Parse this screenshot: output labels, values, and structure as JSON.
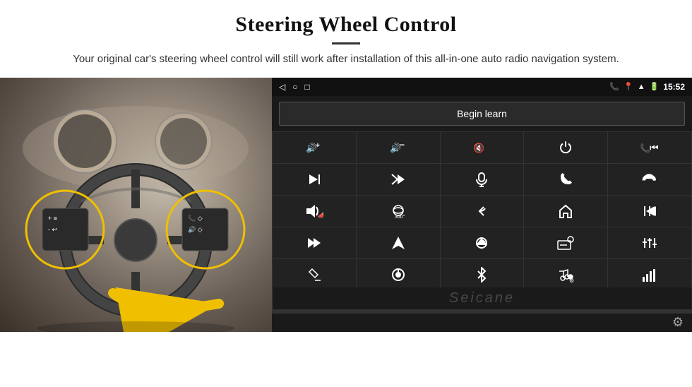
{
  "header": {
    "title": "Steering Wheel Control",
    "subtitle": "Your original car's steering wheel control will still work after installation of this all-in-one auto radio navigation system."
  },
  "status_bar": {
    "time": "15:52",
    "nav_back": "◁",
    "nav_home": "○",
    "nav_recent": "□"
  },
  "begin_learn_btn": "Begin learn",
  "watermark": "Seicane",
  "controls": [
    {
      "icon": "🔊+",
      "name": "vol-up"
    },
    {
      "icon": "🔊−",
      "name": "vol-down"
    },
    {
      "icon": "🔇",
      "name": "mute"
    },
    {
      "icon": "⏻",
      "name": "power"
    },
    {
      "icon": "📞⏮",
      "name": "call-prev"
    },
    {
      "icon": "⏭",
      "name": "next-track"
    },
    {
      "icon": "✂⏭",
      "name": "fast-forward"
    },
    {
      "icon": "🎤",
      "name": "mic"
    },
    {
      "icon": "📞",
      "name": "call"
    },
    {
      "icon": "📞↩",
      "name": "hang-up"
    },
    {
      "icon": "📣",
      "name": "speaker"
    },
    {
      "icon": "360°",
      "name": "camera-360"
    },
    {
      "icon": "↩",
      "name": "back"
    },
    {
      "icon": "🏠",
      "name": "home"
    },
    {
      "icon": "⏮⏮",
      "name": "prev-track"
    },
    {
      "icon": "⏭⏭",
      "name": "fast-next"
    },
    {
      "icon": "➤",
      "name": "nav"
    },
    {
      "icon": "⏏",
      "name": "eject"
    },
    {
      "icon": "📻",
      "name": "radio"
    },
    {
      "icon": "≡|",
      "name": "equalizer"
    },
    {
      "icon": "🎤✏",
      "name": "edit-mic"
    },
    {
      "icon": "🔘",
      "name": "knob"
    },
    {
      "icon": "✱",
      "name": "bluetooth"
    },
    {
      "icon": "🎵⚙",
      "name": "music-settings"
    },
    {
      "icon": "|||",
      "name": "bars"
    }
  ]
}
